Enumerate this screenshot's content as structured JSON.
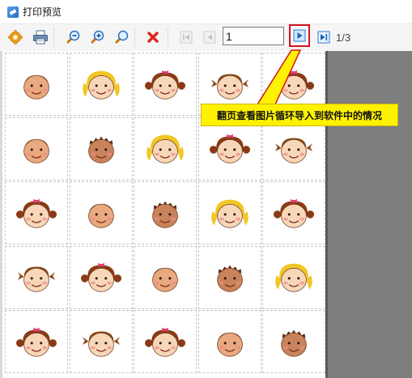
{
  "window": {
    "title": "打印预览",
    "icon": "print-preview-app-icon"
  },
  "toolbar": {
    "buttons": [
      {
        "name": "settings-button",
        "icon": "gear-icon"
      },
      {
        "name": "print-button",
        "icon": "printer-icon"
      },
      {
        "name": "zoom-out-button",
        "icon": "zoom-out-icon"
      },
      {
        "name": "zoom-in-button",
        "icon": "zoom-in-icon"
      },
      {
        "name": "zoom-fit-button",
        "icon": "magnifier-icon"
      },
      {
        "name": "close-preview-button",
        "icon": "red-x-icon"
      },
      {
        "name": "first-page-button",
        "icon": "first-page-icon",
        "disabled": true
      },
      {
        "name": "prev-page-button",
        "icon": "prev-page-icon",
        "disabled": true
      },
      {
        "name": "next-page-button",
        "icon": "next-page-icon"
      },
      {
        "name": "last-page-button",
        "icon": "last-page-icon"
      }
    ],
    "page_input_value": "1",
    "page_count": "1/3"
  },
  "annotation": {
    "text": "翻页查看图片循环导入到软件中的情况",
    "color": "#fff200",
    "border": "#d3141c"
  },
  "faces": [
    "boy-face",
    "girl-blonde-face",
    "girl-bow-face",
    "girl-pigtails-face",
    "girl-bow-face",
    "boy-face",
    "boy-dark-face",
    "girl-blonde-face",
    "girl-bow-face",
    "girl-pigtails-face",
    "girl-bow-face",
    "boy-face",
    "boy-dark-face",
    "girl-blonde-face",
    "girl-bow-face",
    "girl-pigtails-face",
    "girl-bow-face",
    "boy-face",
    "boy-dark-face",
    "girl-blonde-face",
    "girl-bow-face",
    "girl-pigtails-face",
    "girl-bow-face",
    "boy-face",
    "boy-dark-face"
  ]
}
